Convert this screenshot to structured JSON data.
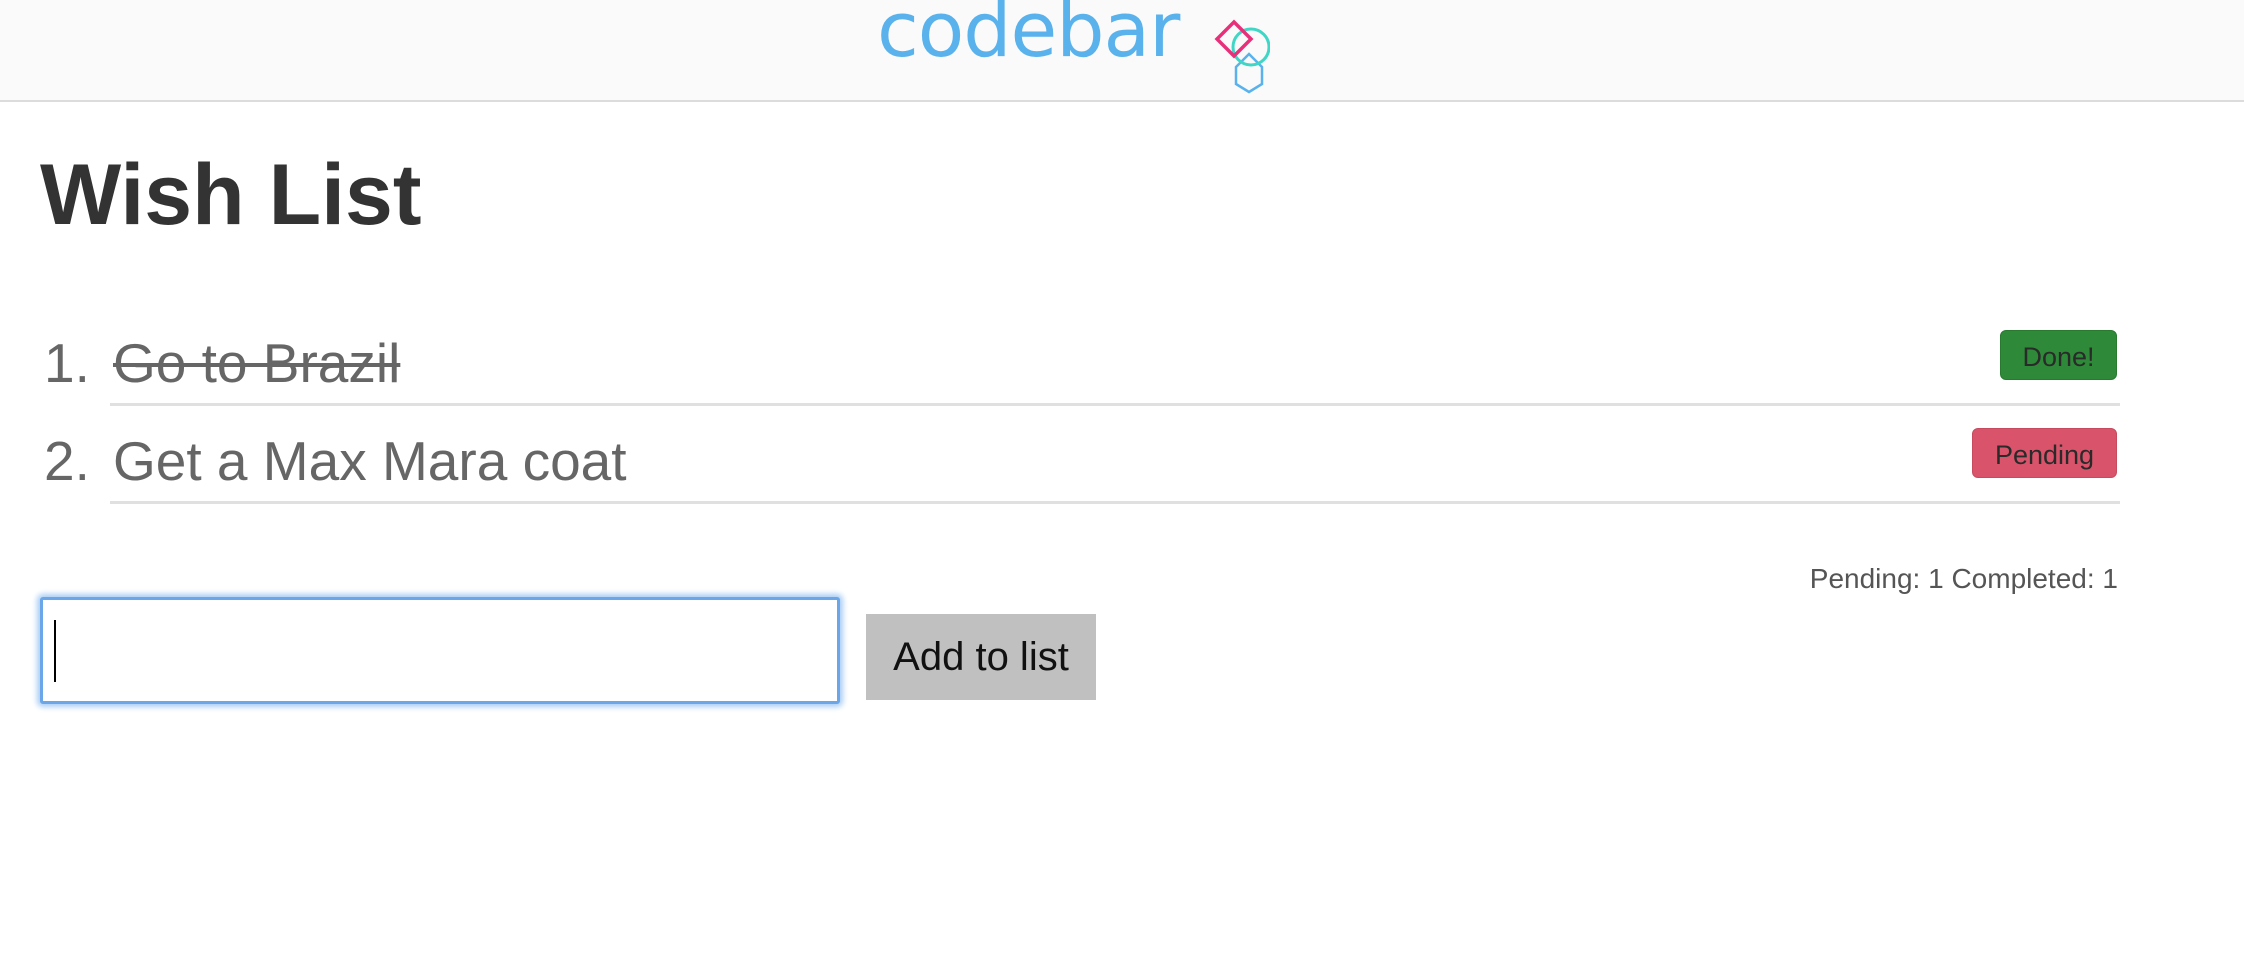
{
  "header": {
    "logo_text": "codebar",
    "colors": {
      "logo_text": "#5ab2ec",
      "mark_pink": "#e8307a",
      "mark_teal": "#3fd6c6",
      "mark_blue": "#5ab2ec"
    }
  },
  "main": {
    "title": "Wish List",
    "items": [
      {
        "number": "1.",
        "text": "Go to Brazil",
        "status_label": "Done!",
        "status": "done"
      },
      {
        "number": "2.",
        "text": "Get a Max Mara coat",
        "status_label": "Pending",
        "status": "pending"
      }
    ],
    "counter": "Pending: 1 Completed: 1",
    "input": {
      "value": "",
      "placeholder": ""
    },
    "add_button_label": "Add to list"
  },
  "colors": {
    "done": "#2e8a38",
    "pending": "#d9546a",
    "input_focus": "#6aa6e8",
    "add_button": "#c0c0c0"
  }
}
